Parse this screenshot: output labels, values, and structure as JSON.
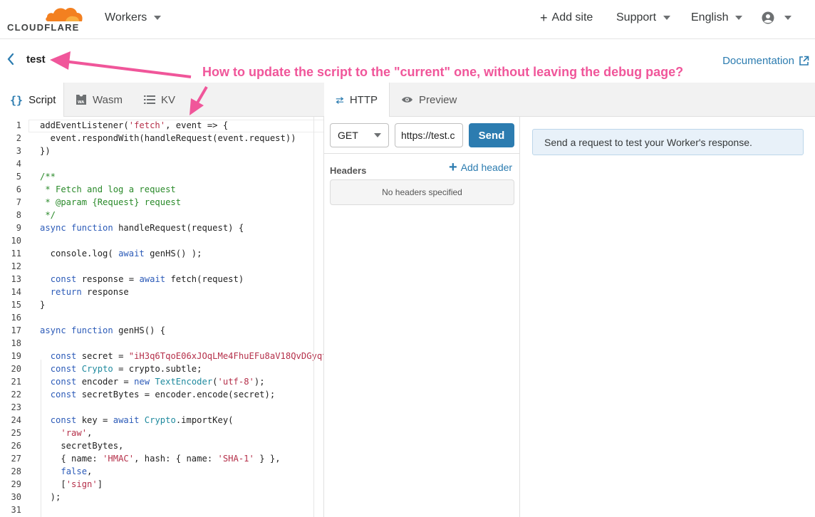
{
  "header": {
    "logo_text": "CLOUDFLARE",
    "workers_label": "Workers",
    "add_site_label": "Add site",
    "support_label": "Support",
    "language_label": "English"
  },
  "subheader": {
    "script_name": "test",
    "documentation_label": "Documentation"
  },
  "annotation": {
    "text": "How to update the script to the \"current\" one, without leaving the debug page?"
  },
  "editor_tabs": [
    {
      "label": "Script",
      "icon": "braces-icon"
    },
    {
      "label": "Wasm",
      "icon": "wasm-icon"
    },
    {
      "label": "KV",
      "icon": "list-icon"
    }
  ],
  "code": {
    "line_numbers": [
      "1",
      "2",
      "3",
      "4",
      "5",
      "6",
      "7",
      "8",
      "9",
      "10",
      "11",
      "12",
      "13",
      "14",
      "15",
      "16",
      "17",
      "18",
      "19",
      "20",
      "21",
      "22",
      "23",
      "24",
      "25",
      "26",
      "27",
      "28",
      "29",
      "30",
      "31"
    ]
  },
  "preview_tabs": [
    {
      "label": "HTTP",
      "icon": "swap-arrows-icon"
    },
    {
      "label": "Preview",
      "icon": "eye-icon"
    }
  ],
  "request": {
    "method": "GET",
    "url": "https://test.c",
    "send_label": "Send",
    "headers_label": "Headers",
    "add_header_label": "Add header",
    "no_headers_label": "No headers specified"
  },
  "response": {
    "info_text": "Send a request to test your Worker's response."
  },
  "colors": {
    "accent": "#2c7cb0",
    "brand_orange": "#f38020",
    "annotation": "#f0569a"
  }
}
